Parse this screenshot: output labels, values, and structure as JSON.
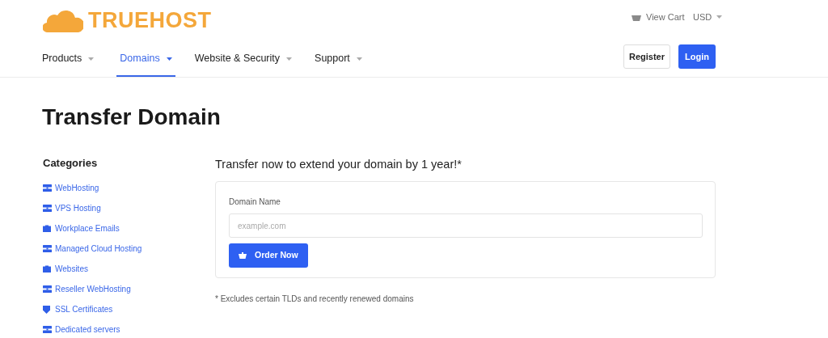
{
  "logo": {
    "text": "TRUEHOST"
  },
  "top_bar": {
    "cart": "View Cart",
    "currency": "USD"
  },
  "nav": [
    {
      "label": "Products",
      "selected": false
    },
    {
      "label": "Domains",
      "selected": true
    },
    {
      "label": "Website & Security",
      "selected": false
    },
    {
      "label": "Support",
      "selected": false
    }
  ],
  "auth_buttons": {
    "register": "Register",
    "login": "Login"
  },
  "page_title": "Transfer Domain",
  "sidebar": {
    "title": "Categories",
    "items": [
      {
        "label": "WebHosting",
        "kind": "server"
      },
      {
        "label": "VPS Hosting",
        "kind": "server"
      },
      {
        "label": "Workplace Emails",
        "kind": "briefcase"
      },
      {
        "label": "Managed Cloud Hosting",
        "kind": "server"
      },
      {
        "label": "Websites",
        "kind": "briefcase"
      },
      {
        "label": "Reseller WebHosting",
        "kind": "server"
      },
      {
        "label": "SSL Certificates",
        "kind": "shield"
      },
      {
        "label": "Dedicated servers",
        "kind": "server"
      }
    ]
  },
  "transfer": {
    "heading": "Transfer now to extend your domain by 1 year!*",
    "field_label": "Domain Name",
    "placeholder": "example.com",
    "button": "Order Now",
    "footnote": "* Excludes certain TLDs and recently renewed domains"
  }
}
